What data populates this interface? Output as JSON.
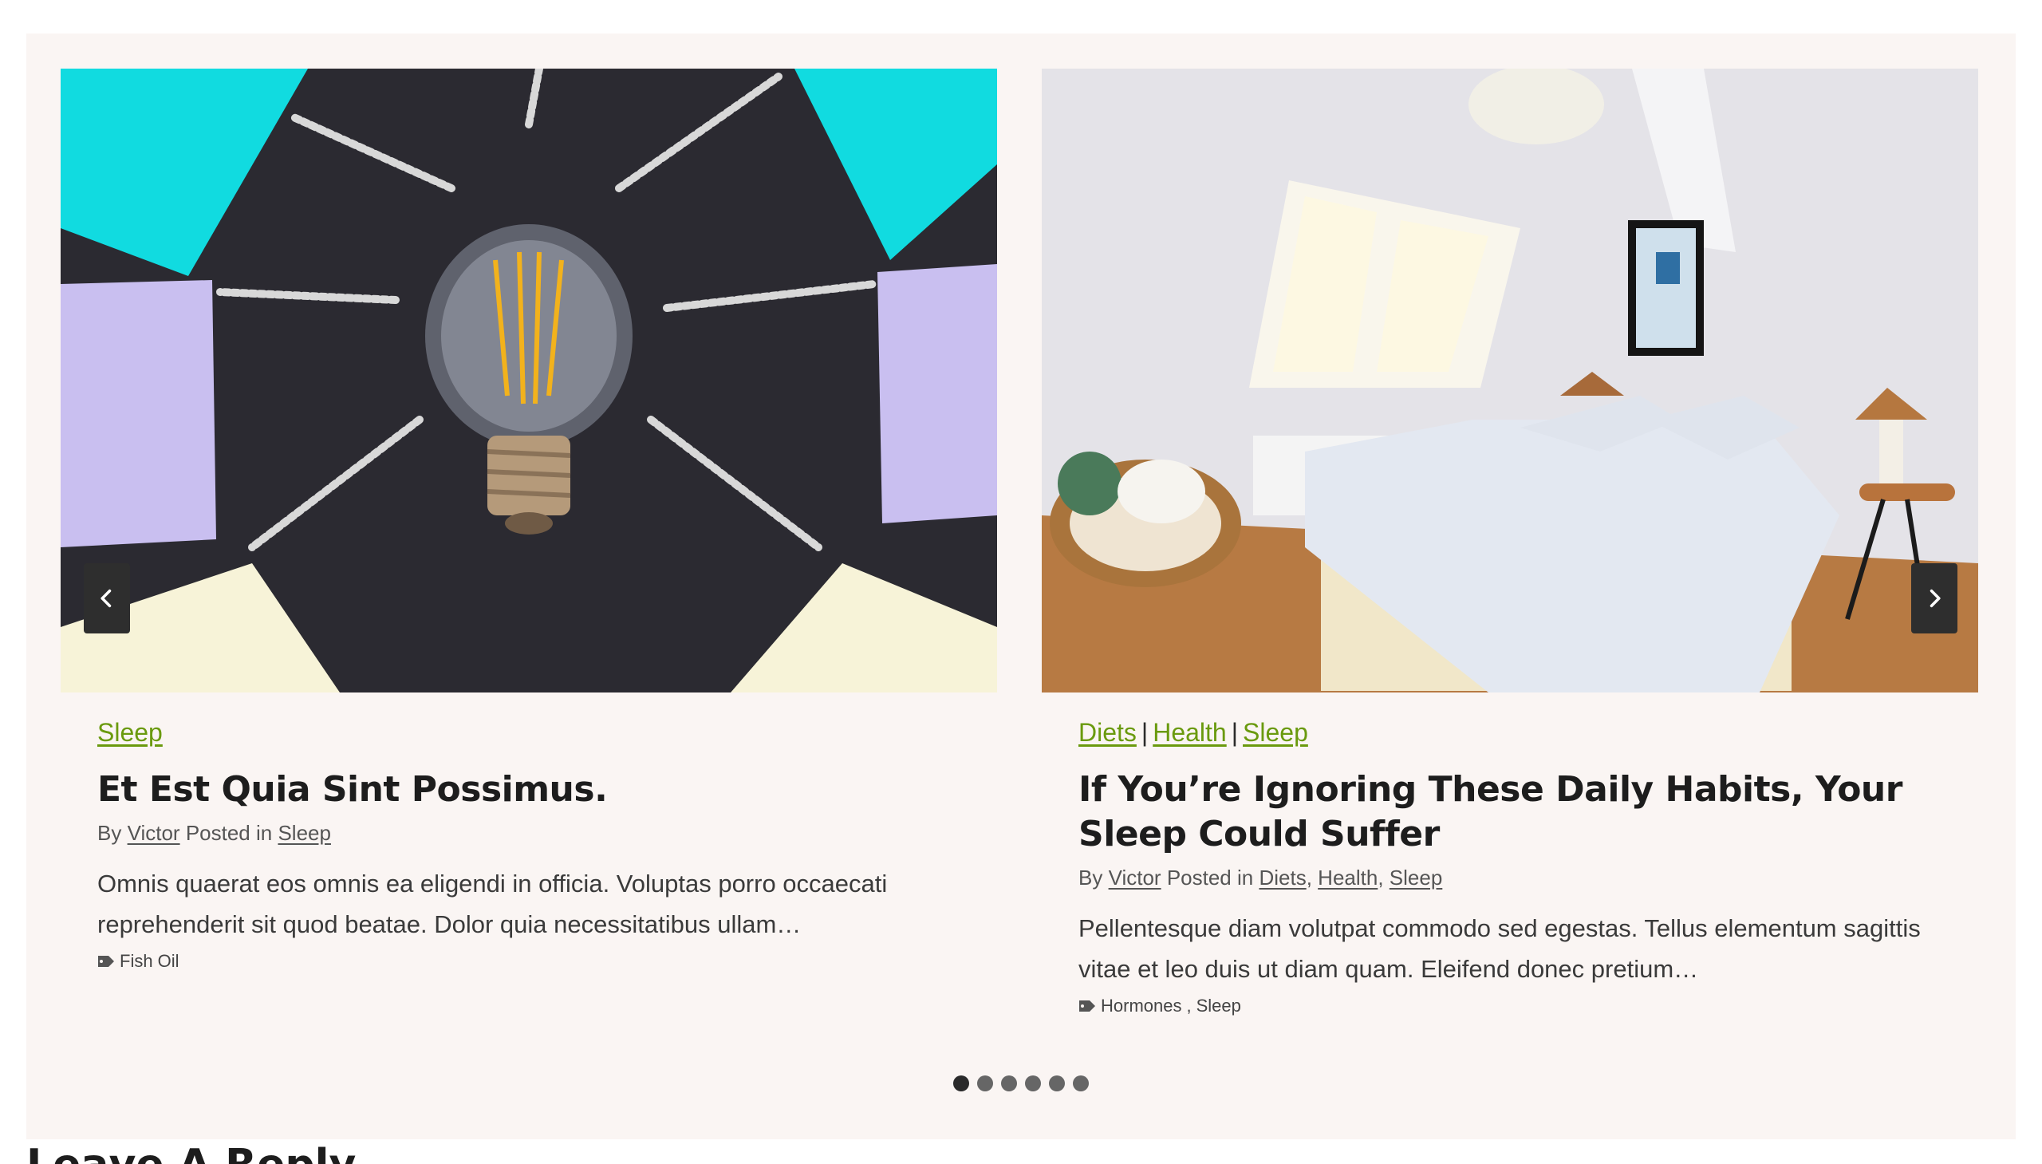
{
  "slider": {
    "prev_icon": "chevron-left-icon",
    "next_icon": "chevron-right-icon",
    "dots_count": 6,
    "active_dot": 1
  },
  "posts": [
    {
      "image": "light-bulb-chalk-rays-photo",
      "categories": [
        "Sleep"
      ],
      "title": "Et Est Quia Sint Possimus.",
      "by_label": "By",
      "author": "Victor",
      "posted_label": "Posted in",
      "posted_in": [
        "Sleep"
      ],
      "excerpt": "Omnis quaerat eos omnis ea eligendi in officia. Voluptas porro occaecati reprehenderit sit quod beatae. Dolor quia necessitatibus ullam…",
      "tags": [
        "Fish Oil"
      ]
    },
    {
      "image": "bright-attic-bedroom-photo",
      "categories": [
        "Diets",
        "Health",
        "Sleep"
      ],
      "title": "If You’re Ignoring These Daily Habits, Your Sleep Could Suffer",
      "by_label": "By",
      "author": "Victor",
      "posted_label": "Posted in",
      "posted_in": [
        "Diets",
        "Health",
        "Sleep"
      ],
      "excerpt": "Pellentesque diam volutpat commodo sed egestas. Tellus elementum sagittis vitae et leo duis ut diam quam. Eleifend donec pretium…",
      "tags": [
        "Hormones",
        "Sleep"
      ]
    }
  ],
  "separators": {
    "category": "|",
    "list": ","
  },
  "reply": {
    "heading": "Leave A Reply"
  },
  "colors": {
    "accent": "#6a9a0e",
    "section_bg": "#faf5f3",
    "nav_bg": "#2e2e2e"
  }
}
